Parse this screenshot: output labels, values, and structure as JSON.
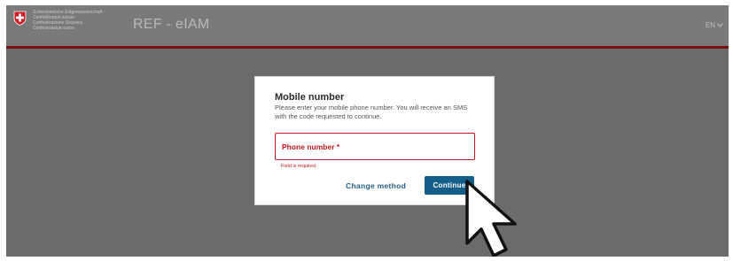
{
  "header": {
    "confederation_lines": [
      "Schweizerische Eidgenossenschaft",
      "Confédération suisse",
      "Confederazione Svizzera",
      "Confederaziun svizra"
    ],
    "app_title": "REF - eIAM",
    "language": "EN"
  },
  "dialog": {
    "title": "Mobile number",
    "description": "Please enter your mobile phone number. You will receive an SMS with the code requested to continue.",
    "phone_label": "Phone number *",
    "error_text": "Field is required",
    "change_method_label": "Change method",
    "continue_label": "Continue"
  },
  "colors": {
    "brand_red": "#c4171b",
    "header_line": "#7a0f14",
    "primary_button": "#145e8c",
    "overlay": "#6b6b6b"
  },
  "icons": {
    "logo": "swiss-cross-shield-icon",
    "language_caret": "chevron-down-icon",
    "pointer": "hand-cursor-icon"
  }
}
